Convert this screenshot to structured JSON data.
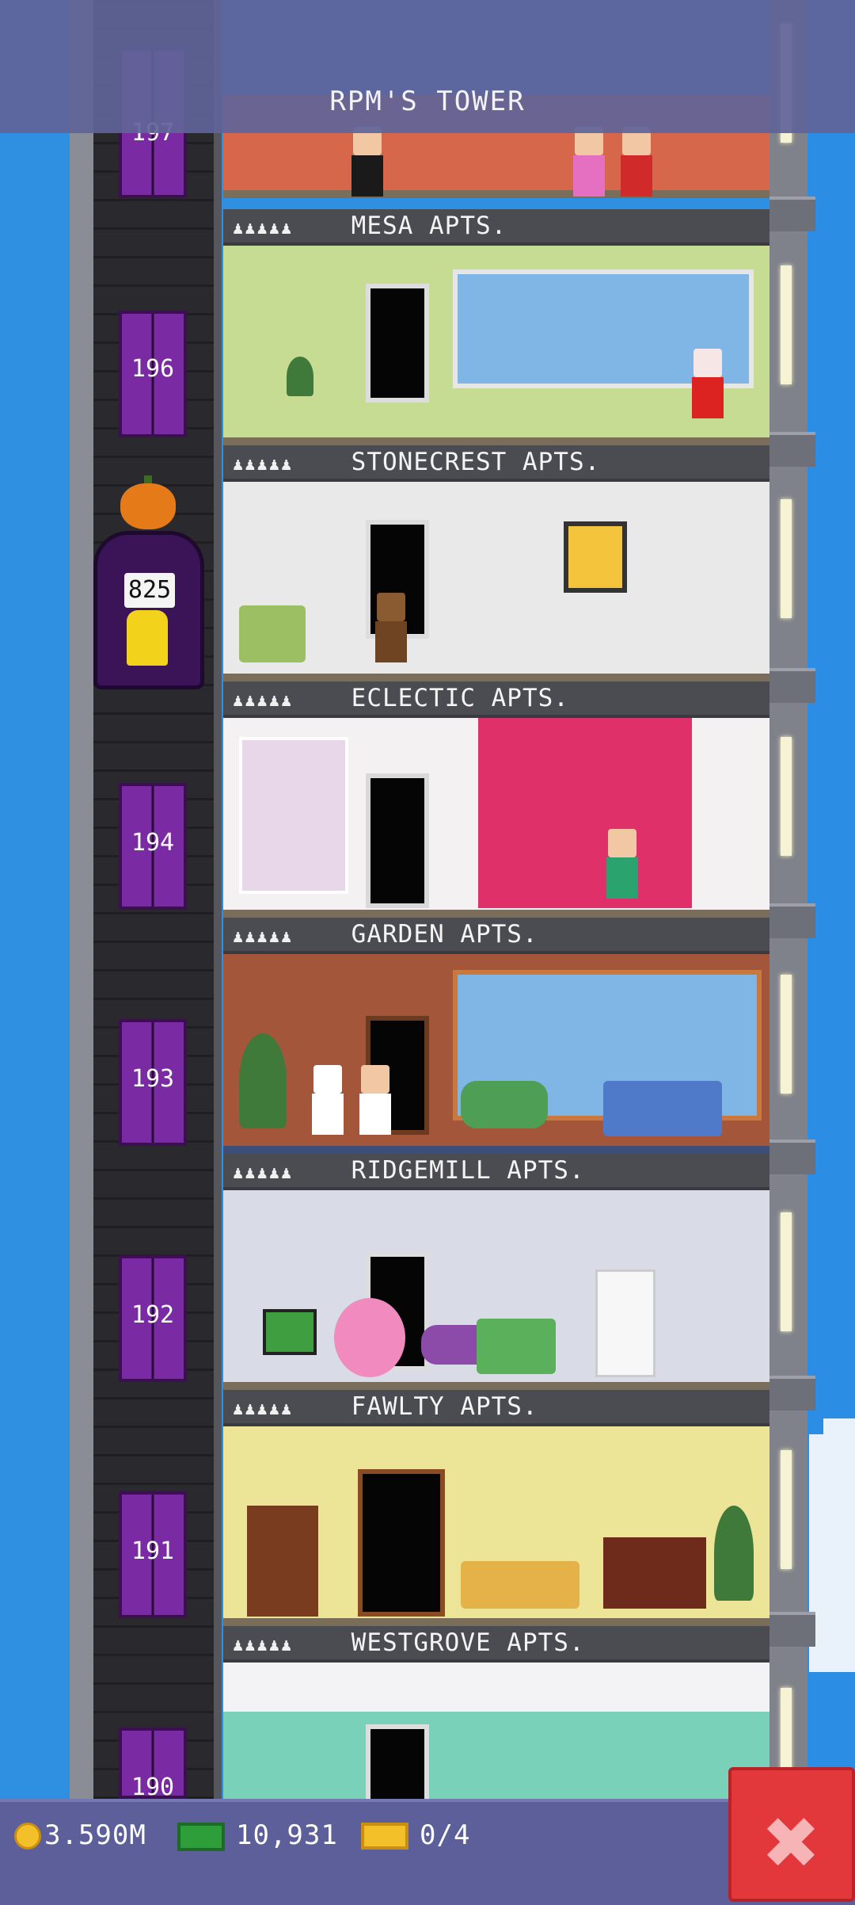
{
  "header": {
    "title": "RPM'S TOWER"
  },
  "floors": [
    {
      "name": "MESA APTS.",
      "persons": "♟♟♟♟♟",
      "elevator_floor": "196",
      "wall": "#c7dc93"
    },
    {
      "name": "STONECREST APTS.",
      "persons": "♟♟♟♟♟",
      "elevator_floor": "",
      "wall": "#e9e9ea"
    },
    {
      "name": "ECLECTIC APTS.",
      "persons": "♟♟♟♟♟",
      "elevator_floor": "194",
      "wall": "#f4f1f3"
    },
    {
      "name": "GARDEN APTS.",
      "persons": "♟♟♟♟♟",
      "elevator_floor": "193",
      "wall": "#a4563a"
    },
    {
      "name": "RIDGEMILL APTS.",
      "persons": "♟♟♟♟♟",
      "elevator_floor": "192",
      "wall": "#d9dbe6"
    },
    {
      "name": "FAWLTY APTS.",
      "persons": "♟♟♟♟♟",
      "elevator_floor": "191",
      "wall": "#ece496"
    },
    {
      "name": "WESTGROVE APTS.",
      "persons": "♟♟♟♟♟",
      "elevator_floor": "190",
      "wall": "#78d1b8"
    }
  ],
  "top_floor_elevator": "197",
  "elevator_car": {
    "counter": "825"
  },
  "status": {
    "coins": "3.590M",
    "bux": "10,931",
    "tickets": "0/4"
  },
  "icons": {
    "coin": "coin-icon",
    "bux": "cash-icon",
    "ticket": "ticket-icon",
    "close": "close-icon"
  },
  "close_label": "✖"
}
